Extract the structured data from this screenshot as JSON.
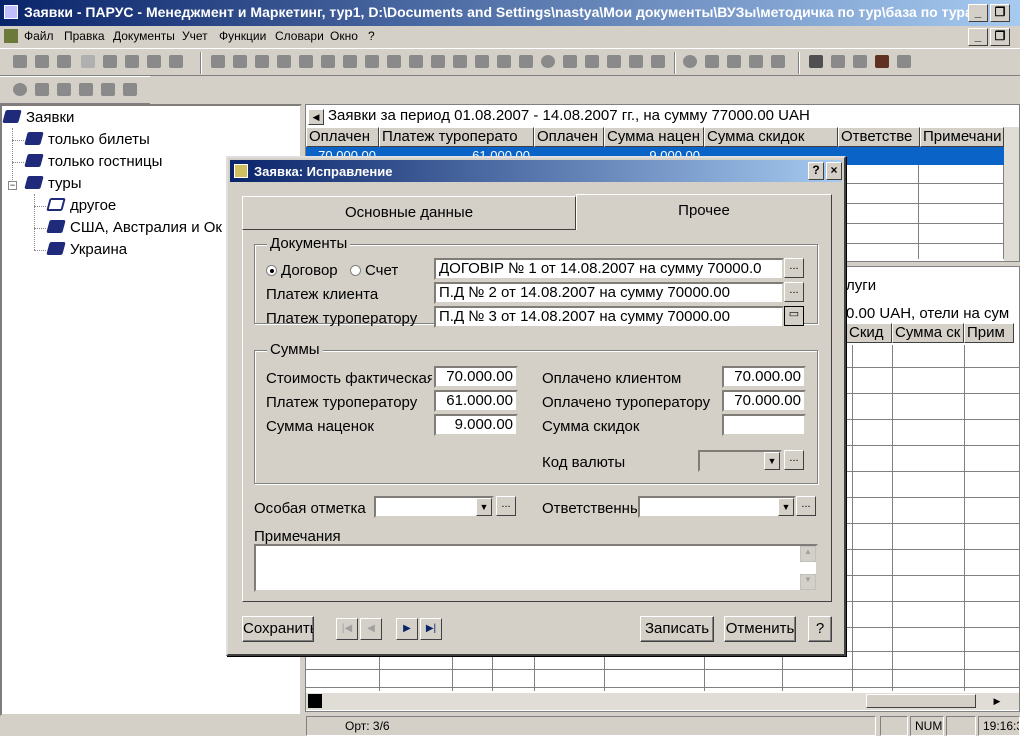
{
  "window": {
    "title": "Заявки - ПАРУС - Менеджмент и Маркетинг, тур1, D:\\Documents and Settings\\nastya\\Мои документы\\ВУЗы\\методичка по тур\\база по турагентств..."
  },
  "menu": {
    "items": [
      "Файл",
      "Правка",
      "Документы",
      "Учет",
      "Функции",
      "Словари",
      "Окно",
      "?"
    ]
  },
  "tree": {
    "root": "Заявки",
    "items": [
      "только билеты",
      "только гостницы",
      "туры"
    ],
    "children": [
      "другое",
      "США, Австралия и Ок",
      "Украина"
    ]
  },
  "grid_top": {
    "caption": "Заявки за период 01.08.2007 - 14.08.2007 гг., на сумму 77000.00 UAH",
    "columns": [
      "Оплачен",
      "Платеж туроперато",
      "Оплачен",
      "Сумма нацен",
      "Сумма скидок",
      "Ответстве",
      "Примечани"
    ],
    "row": [
      "70.000.00",
      "61.000.00",
      "",
      "9.000.00",
      "",
      "",
      ""
    ]
  },
  "grid_bottom": {
    "tab_label": "луги",
    "caption": "0.00 UAH, отели на сум",
    "columns": [
      "Скид",
      "Сумма ск",
      "Прим"
    ]
  },
  "status": {
    "record": "Орт: 3/6",
    "num": "NUM",
    "time": "19:16:34"
  },
  "dialog": {
    "title": "Заявка: Исправление",
    "help_btn": "?",
    "close_btn": "×",
    "tabs": [
      "Основные данные",
      "Прочее"
    ],
    "documents": {
      "group": "Документы",
      "radio_contract": "Договор",
      "radio_invoice": "Счет",
      "contract_value": "ДОГОВІР № 1 от 14.08.2007 на сумму 70000.0",
      "client_payment_label": "Платеж клиента",
      "client_payment_value": "П.Д № 2 от 14.08.2007 на сумму 70000.00",
      "operator_payment_label": "Платеж туроператору",
      "operator_payment_value": "П.Д № 3 от 14.08.2007 на сумму 70000.00"
    },
    "sums": {
      "group": "Суммы",
      "actual_cost_label": "Стоимость фактическая",
      "actual_cost": "70.000.00",
      "operator_payment_label": "Платеж туроператору",
      "operator_payment": "61.000.00",
      "markup_label": "Сумма наценок",
      "markup": "9.000.00",
      "paid_client_label": "Оплачено клиентом",
      "paid_client": "70.000.00",
      "paid_operator_label": "Оплачено туроператору",
      "paid_operator": "70.000.00",
      "discounts_label": "Сумма скидок",
      "discounts": "",
      "currency_label": "Код валюты",
      "currency": ""
    },
    "special_mark_label": "Особая отметка",
    "special_mark": "",
    "responsible_label": "Ответственный",
    "responsible": "",
    "notes_label": "Примечания",
    "notes": "",
    "buttons": {
      "save": "Сохранить",
      "record": "Записать",
      "cancel": "Отменить",
      "help": "?"
    },
    "nav": [
      "|◀",
      "◀",
      "▶",
      "▶|"
    ]
  }
}
